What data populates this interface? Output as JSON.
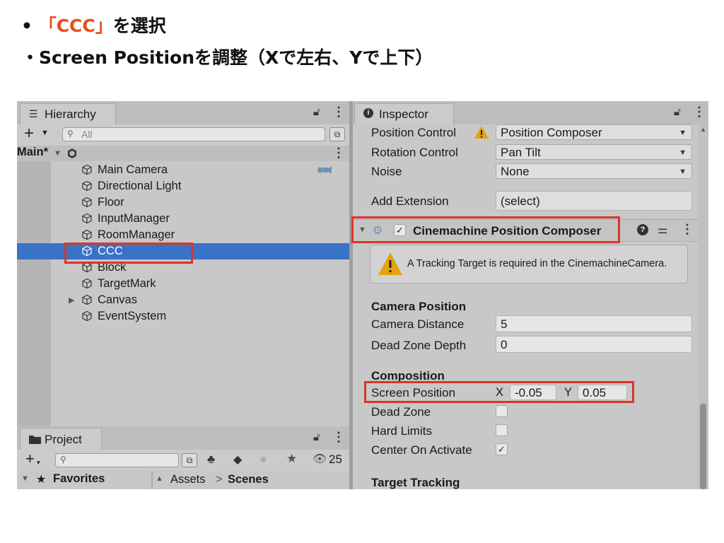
{
  "slide": {
    "line1_bullet": "•",
    "line1_highlight": "「CCC」",
    "line1_rest": "を選択",
    "line2": "・Screen Positionを調整（Xで左右、Yで上下）"
  },
  "hierarchy": {
    "tab_label": "Hierarchy",
    "search_placeholder": "All",
    "scene_name": "Main*",
    "items": [
      {
        "label": "Main Camera"
      },
      {
        "label": "Directional Light"
      },
      {
        "label": "Floor"
      },
      {
        "label": "InputManager"
      },
      {
        "label": "RoomManager"
      },
      {
        "label": "CCC",
        "selected": true
      },
      {
        "label": "Block"
      },
      {
        "label": "TargetMark"
      },
      {
        "label": "Canvas",
        "expandable": true
      },
      {
        "label": "EventSystem"
      }
    ]
  },
  "project": {
    "tab_label": "Project",
    "hidden_count": "25",
    "favorites_label": "Favorites",
    "breadcrumb_assets": "Assets",
    "breadcrumb_sep": ">",
    "breadcrumb_scenes": "Scenes"
  },
  "inspector": {
    "tab_label": "Inspector",
    "position_control_label": "Position Control",
    "position_control_value": "Position Composer",
    "rotation_control_label": "Rotation Control",
    "rotation_control_value": "Pan Tilt",
    "noise_label": "Noise",
    "noise_value": "None",
    "add_extension_label": "Add Extension",
    "add_extension_value": "(select)",
    "component_title": "Cinemachine Position Composer",
    "warning_text": "A Tracking Target is required in the CinemachineCamera.",
    "camera_position_header": "Camera Position",
    "camera_distance_label": "Camera Distance",
    "camera_distance_value": "5",
    "dead_zone_depth_label": "Dead Zone Depth",
    "dead_zone_depth_value": "0",
    "composition_header": "Composition",
    "screen_position_label": "Screen Position",
    "screen_x_label": "X",
    "screen_x_value": "-0.05",
    "screen_y_label": "Y",
    "screen_y_value": "0.05",
    "dead_zone_label": "Dead Zone",
    "hard_limits_label": "Hard Limits",
    "center_on_activate_label": "Center On Activate",
    "target_tracking_header": "Target Tracking"
  },
  "colors": {
    "selection": "#3a72c6",
    "annotation_red": "#d9352a",
    "highlight_text": "#e84e1c",
    "warning_yellow": "#e3a20f"
  }
}
